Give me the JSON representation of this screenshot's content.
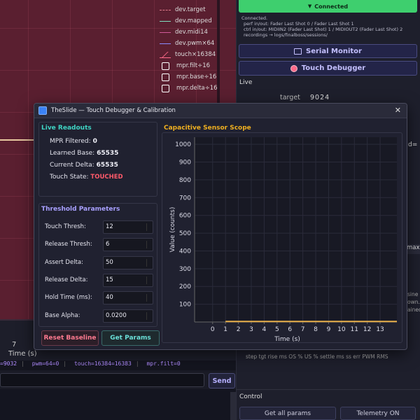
{
  "background_plot": {
    "legend": [
      {
        "label": "dev.target",
        "color": "#e07a8a",
        "style": "dashed"
      },
      {
        "label": "dev.mapped",
        "color": "#7fe0c0",
        "style": "solid"
      },
      {
        "label": "dev.midi14",
        "color": "#d05a9a",
        "style": "solid"
      },
      {
        "label": "dev.pwm×64",
        "color": "#8a8cff",
        "style": "solid"
      },
      {
        "label": "touch×16384",
        "color": "#ff6a8a",
        "style": "fill"
      },
      {
        "label": "mpr.filt÷16",
        "color": "#ffffff",
        "style": "icon"
      },
      {
        "label": "mpr.base÷16",
        "color": "#ffffff",
        "style": "icon"
      },
      {
        "label": "mpr.delta÷16",
        "color": "#ffffff",
        "style": "icon"
      }
    ],
    "x_tick": "7",
    "x_label": "Time (s)"
  },
  "status_bar": {
    "items": [
      "=9032",
      "pwm=64=0",
      "touch=16384=16383",
      "mpr.filt=0"
    ]
  },
  "send": {
    "label": "Send",
    "input_value": ""
  },
  "right_panel": {
    "connection_status": "Connected",
    "log_lines": [
      "Connected.",
      "perf in/out:  Fader Last Shot 0  /  Fader Last Shot 1",
      "ctrl in/out:  MIDIIN2 (Fader Last Shot) 1  /  MIDIOUT2 (Fader Last Shot) 2",
      "recordings → logs/finalboss/sessions/"
    ],
    "serial_monitor_label": "Serial Monitor",
    "touch_debugger_label": "Touch Debugger",
    "live_label": "Live",
    "live_target_label": "target",
    "live_target_value": "9024",
    "peek_right_text": "d=",
    "peek_max_text": "max",
    "peek_sine_lines": [
      "sine",
      "own.",
      "ained"
    ],
    "metric_headers": "step   tgt   rise ms  OS %  US %  settle ms  ss err  PWM RMS",
    "control_label": "Control",
    "get_all_params_label": "Get all params",
    "telemetry_label": "Telemetry ON",
    "colors": {
      "connected": "#3ecf6e",
      "accent": "#c4c0ff"
    }
  },
  "dialog": {
    "title": "TheSlide — Touch Debugger & Calibration",
    "live_readouts": {
      "title": "Live Readouts",
      "rows": [
        {
          "label": "MPR Filtered:",
          "value": "0"
        },
        {
          "label": "Learned Base:",
          "value": "65535"
        },
        {
          "label": "Current Delta:",
          "value": "65535"
        },
        {
          "label": "Touch State:",
          "value": "TOUCHED"
        }
      ],
      "touched_color": "#ff5a6a"
    },
    "threshold": {
      "title": "Threshold Parameters",
      "params": [
        {
          "label": "Touch Thresh:",
          "value": "12"
        },
        {
          "label": "Release Thresh:",
          "value": "6"
        },
        {
          "label": "Assert Delta:",
          "value": "50"
        },
        {
          "label": "Release Delta:",
          "value": "15"
        },
        {
          "label": "Hold Time (ms):",
          "value": "40"
        },
        {
          "label": "Base Alpha:",
          "value": "0.0200"
        }
      ]
    },
    "reset_baseline_label": "Reset Baseline",
    "get_params_label": "Get Params",
    "scope": {
      "title": "Capacitive Sensor Scope"
    }
  },
  "chart_data": {
    "type": "line",
    "title": "Capacitive Sensor Scope",
    "xlabel": "Time (s)",
    "ylabel": "Value (counts)",
    "x_ticks": [
      0,
      1,
      2,
      3,
      4,
      5,
      6,
      7,
      8,
      9,
      10,
      11,
      12,
      13
    ],
    "y_ticks": [
      100,
      200,
      300,
      400,
      500,
      600,
      700,
      800,
      900,
      1000
    ],
    "xlim": [
      -1.4,
      14.3
    ],
    "ylim": [
      0,
      1040
    ],
    "series": [
      {
        "color": "#e8b04a",
        "x": [
          1,
          14.3
        ],
        "y": [
          3,
          3
        ]
      }
    ],
    "grid": true
  }
}
